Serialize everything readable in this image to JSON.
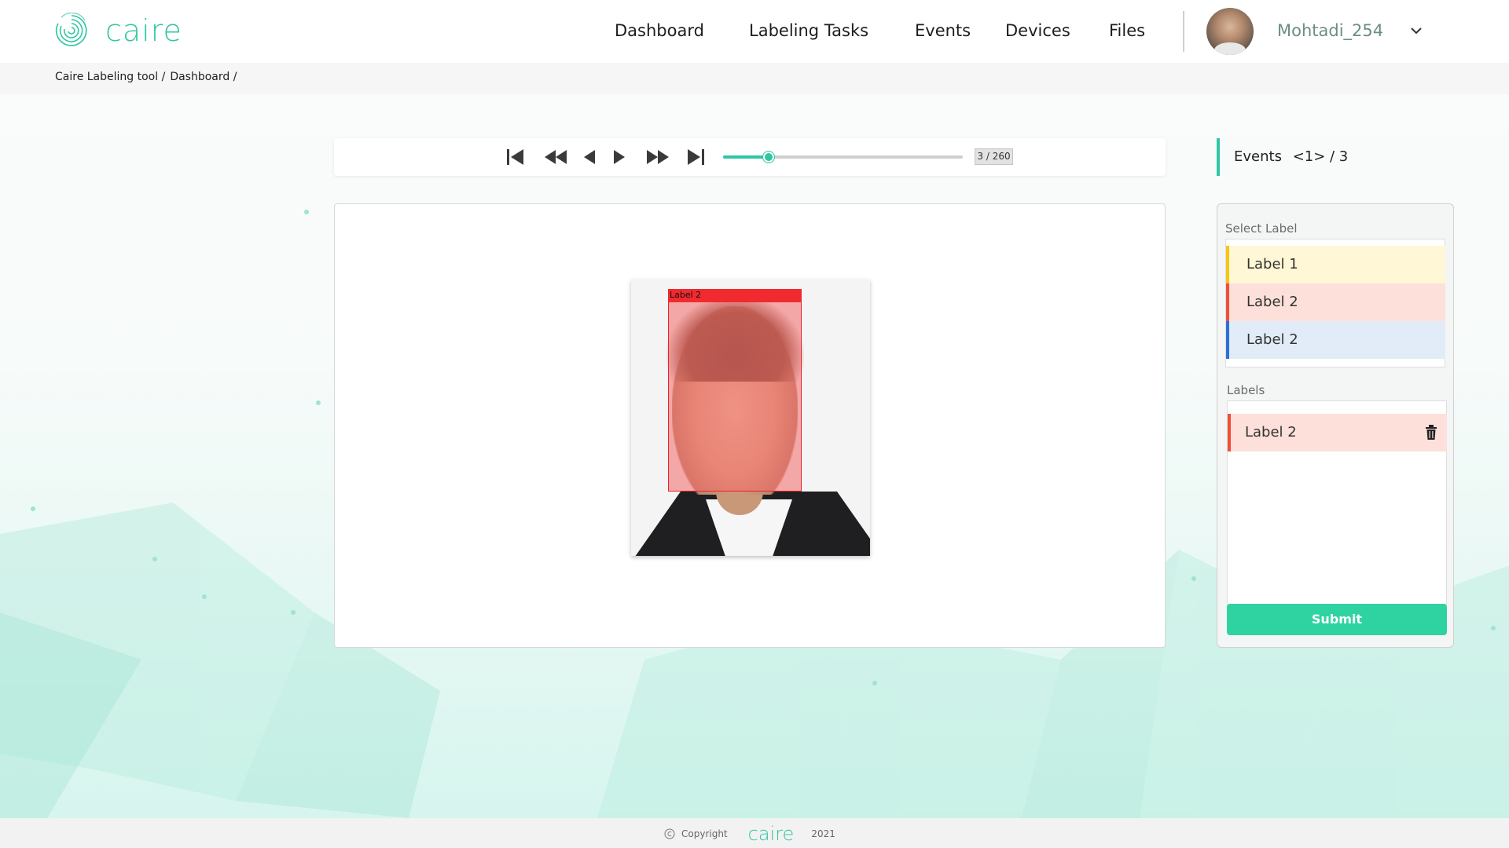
{
  "header": {
    "logo_text": "caire",
    "nav": [
      "Dashboard",
      "Labeling Tasks",
      "Events",
      "Devices",
      "Files"
    ],
    "username": "Mohtadi_254"
  },
  "breadcrumb": [
    "Caire Labeling tool /",
    "Dashboard /"
  ],
  "player": {
    "frame_counter": "3 / 260",
    "progress": 0.19
  },
  "canvas": {
    "bbox_label": "Label 2",
    "bbox_color": "#f12a2f"
  },
  "events": {
    "title": "Events",
    "count": "<1> / 3"
  },
  "panel": {
    "select_label_caption": "Select Label",
    "select_options": [
      {
        "label": "Label 1",
        "color": "#f5c518",
        "bg": "#fff7d6"
      },
      {
        "label": "Label 2",
        "color": "#ef4f3a",
        "bg": "#fde0da"
      },
      {
        "label": "Label 2",
        "color": "#2d6fd6",
        "bg": "#e1ecf8"
      }
    ],
    "labels_caption": "Labels",
    "labels": [
      {
        "label": "Label 2",
        "color": "#ef4f3a"
      }
    ],
    "submit_label": "Submit"
  },
  "footer": {
    "copyright": "Copyright",
    "logo_text": "caire",
    "year": "2021"
  },
  "icons": [
    "caire-logo-icon",
    "chevron-down-icon",
    "skip-start-icon",
    "rewind-icon",
    "step-back-icon",
    "play-icon",
    "fast-forward-icon",
    "skip-end-icon",
    "trash-icon",
    "copyright-icon"
  ]
}
